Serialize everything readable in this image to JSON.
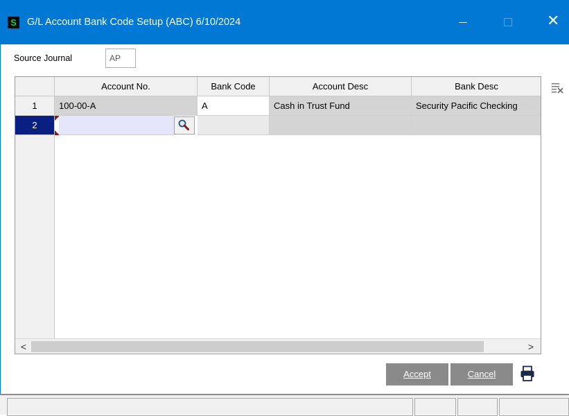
{
  "window": {
    "icon_letter": "S",
    "title": "G/L Account Bank Code Setup (ABC) 6/10/2024",
    "close_glyph": "✕"
  },
  "form": {
    "source_journal_label": "Source Journal",
    "source_journal_value": "AP"
  },
  "grid": {
    "columns": [
      "Account No.",
      "Bank Code",
      "Account Desc",
      "Bank Desc"
    ],
    "rows": [
      {
        "num": "1",
        "account_no": "100-00-A",
        "bank_code": "A",
        "account_desc": "Cash in Trust Fund",
        "bank_desc": "Security Pacific Checking"
      },
      {
        "num": "2",
        "account_no": "",
        "bank_code": "",
        "account_desc": "",
        "bank_desc": ""
      }
    ],
    "scroll_left": "<",
    "scroll_right": ">"
  },
  "buttons": {
    "accept": "Accept",
    "cancel": "Cancel"
  },
  "icons": {
    "app": "sage-s-icon",
    "lookup": "magnifier-icon",
    "grid_options": "clear-grid-icon",
    "print": "printer-icon"
  },
  "colors": {
    "titlebar": "#0078d4",
    "selected_row": "#0a1f82",
    "active_cell": "#e4e4fb",
    "button": "#8a8a8a"
  }
}
